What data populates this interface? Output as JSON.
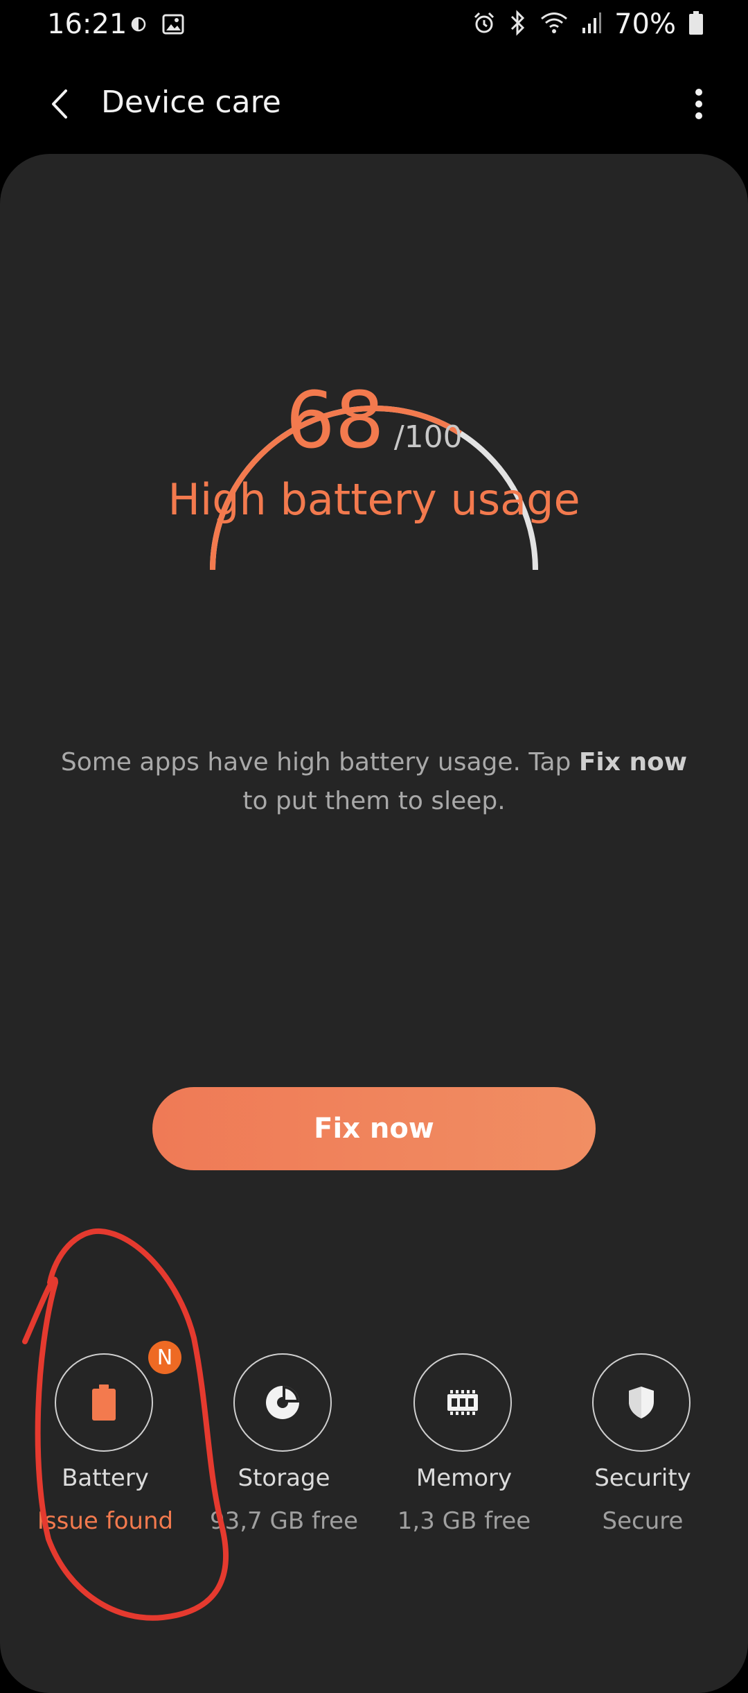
{
  "status_bar": {
    "time": "16:21",
    "battery_percent": "70%",
    "icons": [
      "data-saver-icon",
      "image-icon",
      "alarm-icon",
      "bluetooth-icon",
      "wifi-icon",
      "signal-icon",
      "battery-icon"
    ]
  },
  "app_bar": {
    "title": "Device care"
  },
  "score": {
    "value": "68",
    "total": "/100",
    "fraction": 0.68,
    "status": "High battery usage"
  },
  "message": {
    "before": "Some apps have high battery usage. Tap ",
    "bold": "Fix now",
    "after": " to put them to sleep."
  },
  "fix_button": {
    "label": "Fix now"
  },
  "tiles": [
    {
      "label": "Battery",
      "sub": "Issue found",
      "badge": "N",
      "icon": "battery-icon"
    },
    {
      "label": "Storage",
      "sub": "93,7 GB free",
      "icon": "storage-icon"
    },
    {
      "label": "Memory",
      "sub": "1,3 GB free",
      "icon": "memory-icon"
    },
    {
      "label": "Security",
      "sub": "Secure",
      "icon": "shield-icon"
    }
  ],
  "colors": {
    "accent": "#f37a4e",
    "card_bg": "#252525",
    "background": "#000000",
    "badge": "#ee6a24",
    "annotation": "#e53a2f"
  }
}
